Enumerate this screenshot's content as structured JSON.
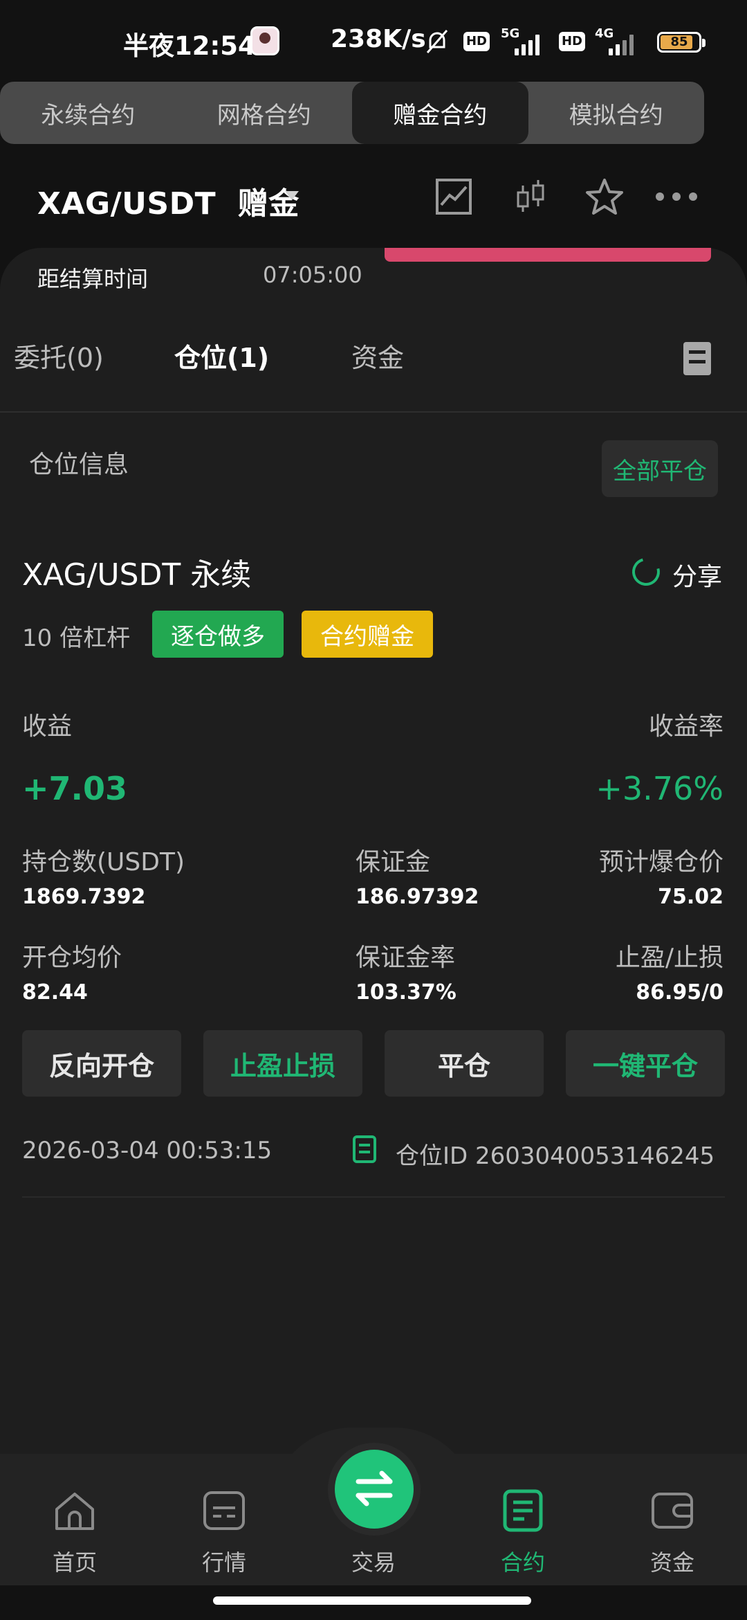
{
  "status_bar": {
    "time": "半夜12:54",
    "speed": "238K/s",
    "hd1": "HD",
    "net1": "5G",
    "hd2": "HD",
    "net2": "4G",
    "battery": "85",
    "battery_percent": 85
  },
  "contract_tabs": [
    {
      "label": "永续合约"
    },
    {
      "label": "网格合约"
    },
    {
      "label": "赠金合约"
    },
    {
      "label": "模拟合约"
    }
  ],
  "header": {
    "pair": "XAG/USDT  赠金"
  },
  "settlement": {
    "label": "距结算时间",
    "time": "07:05:00"
  },
  "sub_tabs": [
    {
      "label": "委托(0)"
    },
    {
      "label": "仓位(1)"
    },
    {
      "label": "资金"
    }
  ],
  "position_section": {
    "label": "仓位信息",
    "close_all": "全部平仓"
  },
  "position": {
    "pair": "XAG/USDT 永续",
    "share": "分享",
    "leverage": "10 倍杠杆",
    "tag_side": "逐仓做多",
    "tag_bonus": "合约赠金",
    "pnl_label": "收益",
    "pnl_rate_label": "收益率",
    "pnl": "+7.03",
    "pnl_rate": "+3.76%",
    "size_label": "持仓数(USDT)",
    "size": "1869.7392",
    "margin_label": "保证金",
    "margin": "186.97392",
    "liq_label": "预计爆仓价",
    "liq": "75.02",
    "entry_label": "开仓均价",
    "entry": "82.44",
    "margin_rate_label": "保证金率",
    "margin_rate": "103.37%",
    "tpsl_label": "止盈/止损",
    "tpsl": "86.95/0",
    "open_time": "2026-03-04 00:53:15",
    "pos_id": "仓位ID 2603040053146245"
  },
  "actions": {
    "reverse": "反向开仓",
    "tpsl": "止盈止损",
    "close": "平仓",
    "quick_close": "一键平仓"
  },
  "nav": {
    "home": "首页",
    "market": "行情",
    "trade": "交易",
    "contract": "合约",
    "funds": "资金"
  },
  "colors": {
    "accent_green": "#20b774",
    "pink": "#d8486c",
    "yellow": "#e8b80c"
  }
}
